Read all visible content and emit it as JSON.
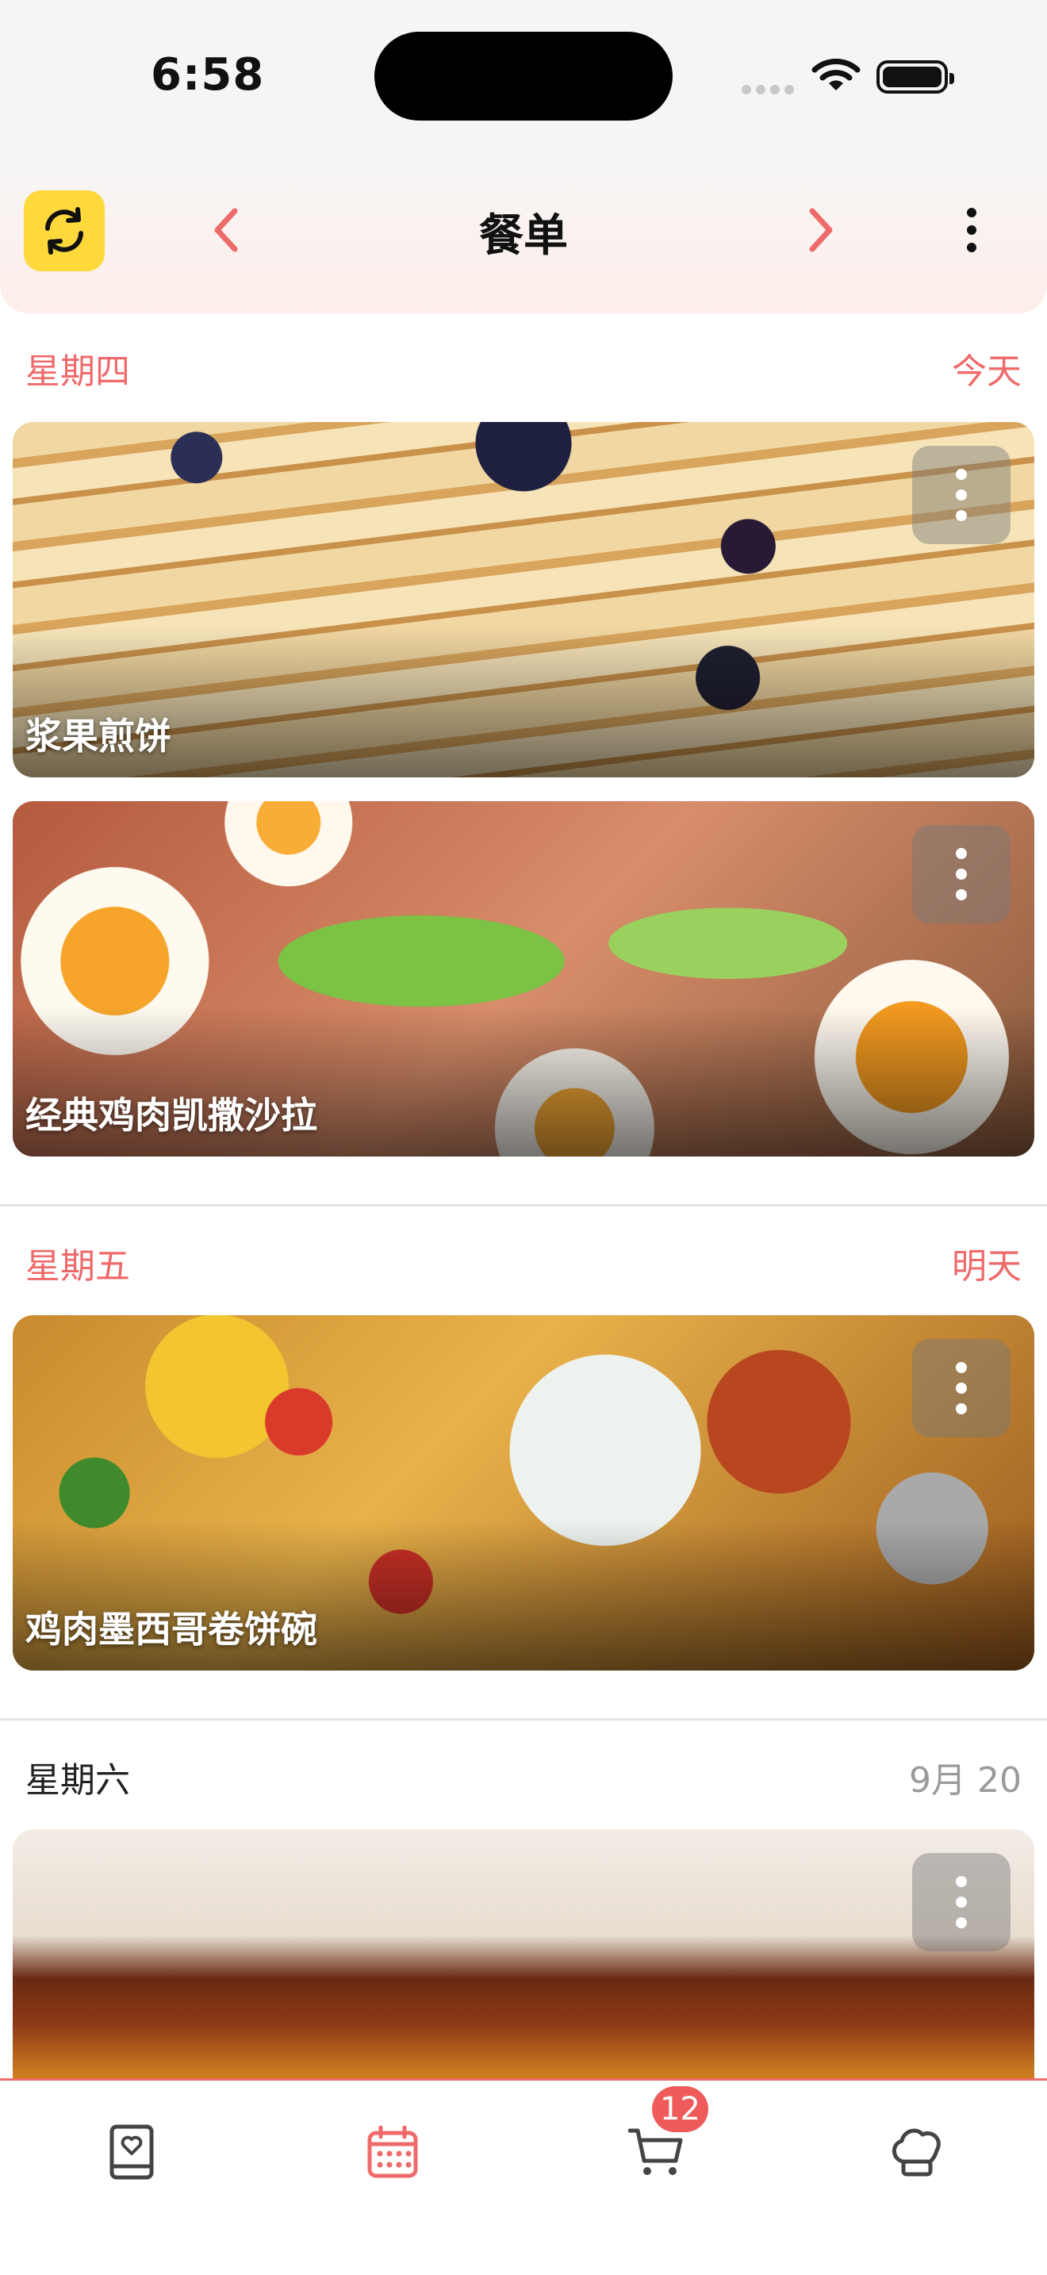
{
  "status_bar": {
    "time": "6:58"
  },
  "header": {
    "title": "餐单"
  },
  "days": [
    {
      "label": "星期四",
      "relative": "今天",
      "meals": [
        {
          "name": "浆果煎饼"
        },
        {
          "name": "经典鸡肉凯撒沙拉"
        }
      ]
    },
    {
      "label": "星期五",
      "relative": "明天",
      "meals": [
        {
          "name": "鸡肉墨西哥卷饼碗"
        }
      ]
    },
    {
      "label": "星期六",
      "relative": "9月 20",
      "meals": [
        {
          "name": ""
        }
      ]
    }
  ],
  "tabbar": {
    "items": [
      "recipe-book-icon",
      "calendar-icon",
      "cart-icon",
      "chef-hat-icon"
    ],
    "active": "calendar-icon",
    "cart_badge": "12"
  },
  "colors": {
    "accent": "#ef6a6a",
    "sync_button": "#ffd93b"
  }
}
